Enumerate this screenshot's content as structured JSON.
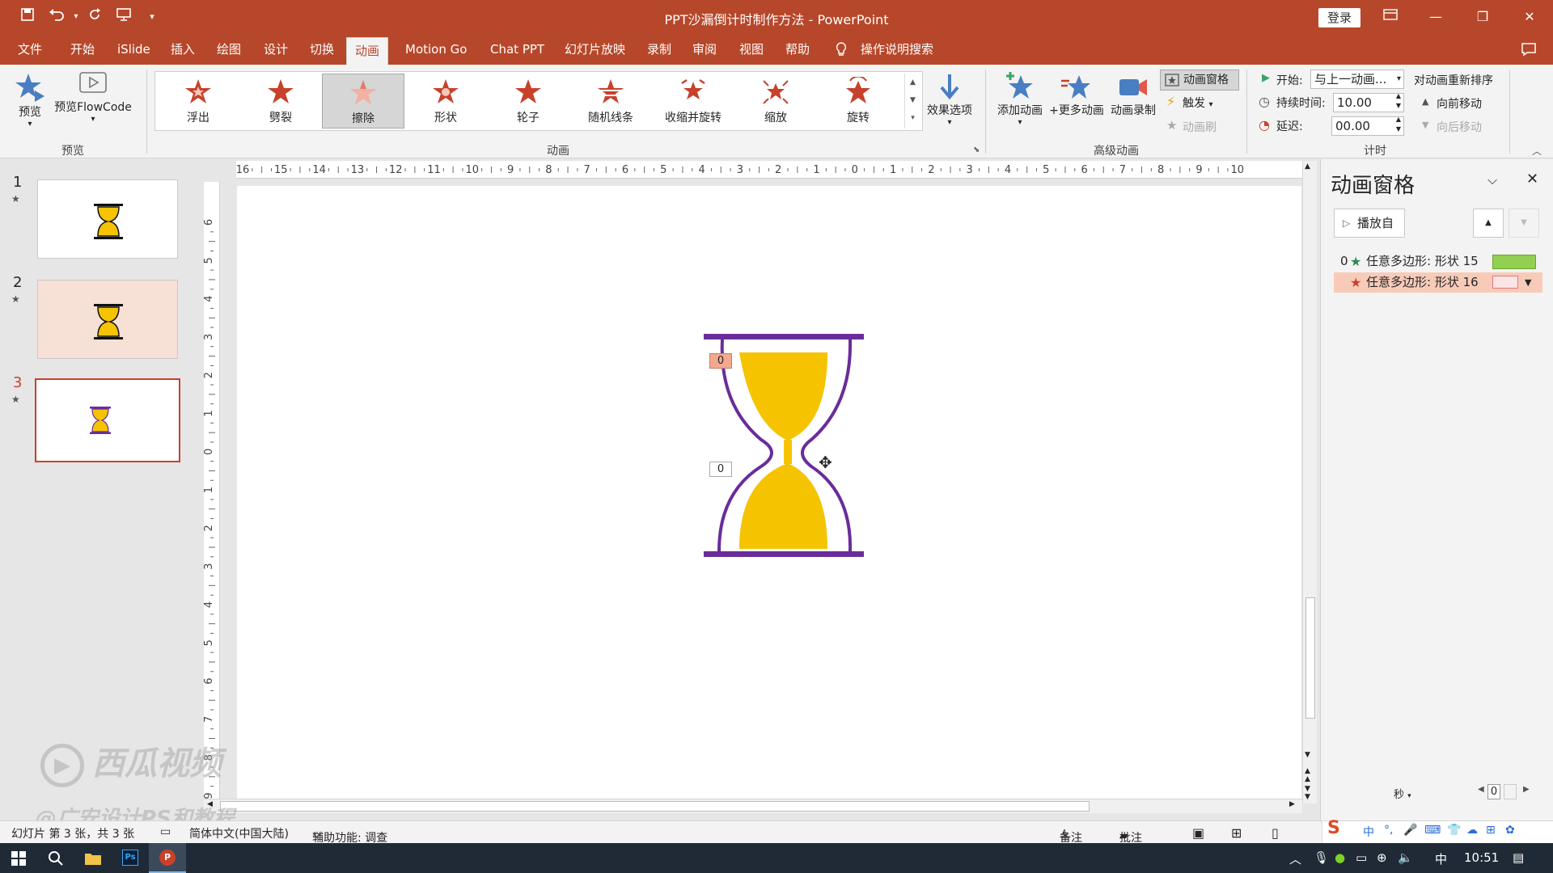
{
  "window": {
    "title": "PPT沙漏倒计时制作方法  -  PowerPoint",
    "login_label": "登录"
  },
  "tabs": [
    "文件",
    "开始",
    "iSlide",
    "插入",
    "绘图",
    "设计",
    "切换",
    "动画",
    "Motion Go",
    "Chat PPT",
    "幻灯片放映",
    "录制",
    "审阅",
    "视图",
    "帮助"
  ],
  "search_label": "操作说明搜索",
  "ribbon": {
    "preview_label": "预览",
    "preview_flowcode_label": "预览FlowCode",
    "group_preview": "预览",
    "gallery": [
      "浮出",
      "劈裂",
      "擦除",
      "形状",
      "轮子",
      "随机线条",
      "收缩并旋转",
      "缩放",
      "旋转"
    ],
    "effect_options_label": "效果选项",
    "group_animation": "动画",
    "add_animation_label": "添加动画",
    "more_animation_label": "+更多动画",
    "record_animation_label": "动画录制",
    "animation_pane_label": "动画窗格",
    "trigger_label": "触发",
    "animation_painter_label": "动画刷",
    "group_advanced": "高级动画",
    "start_label": "开始:",
    "start_value": "与上一动画...",
    "duration_label": "持续时间:",
    "duration_value": "10.00",
    "delay_label": "延迟:",
    "delay_value": "00.00",
    "reorder_label": "对动画重新排序",
    "move_earlier_label": "向前移动",
    "move_later_label": "向后移动",
    "group_timing": "计时"
  },
  "slides": [
    {
      "number": "1",
      "star": "★"
    },
    {
      "number": "2",
      "star": "★"
    },
    {
      "number": "3",
      "star": "★"
    }
  ],
  "hruler_ticks": [
    "16",
    "15",
    "14",
    "13",
    "12",
    "11",
    "10",
    "9",
    "8",
    "7",
    "6",
    "5",
    "4",
    "3",
    "2",
    "1",
    "0",
    "1",
    "2",
    "3",
    "4",
    "5",
    "6",
    "7",
    "8",
    "9",
    "10"
  ],
  "vruler_ticks": [
    "6",
    "5",
    "4",
    "3",
    "2",
    "1",
    "0",
    "1",
    "2",
    "3",
    "4",
    "5",
    "6",
    "7",
    "8",
    "9"
  ],
  "slide_tags": {
    "top": "0",
    "bottom": "0"
  },
  "pane": {
    "title": "动画窗格",
    "play_from_label": "播放自",
    "items": [
      {
        "index": "0",
        "label": "任意多边形: 形状 15",
        "color": "#92d050"
      },
      {
        "index": "",
        "label": "任意多边形: 形状 16",
        "color": "#f4b6b6"
      }
    ],
    "seconds_label": "秒",
    "zoom_value": "0"
  },
  "status": {
    "slide_info": "幻灯片 第 3 张，共 3 张",
    "language": "简体中文(中国大陆)",
    "accessibility": "辅助功能: 调查",
    "notes_label": "备注",
    "comments_label": "批注"
  },
  "taskbar": {
    "time": "10:51",
    "ime_label": "中",
    "ime_tray_label": "中"
  },
  "watermark": {
    "brand": "西瓜视频",
    "author": "@广安设计PS和教程"
  },
  "colors": {
    "accent": "#b7472a",
    "hourglass_frame": "#6a2c9a",
    "sand": "#f5c300"
  }
}
